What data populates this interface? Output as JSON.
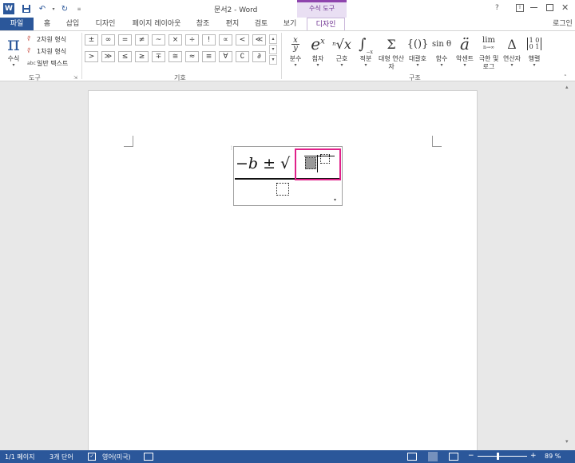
{
  "window": {
    "title": "문서2 - Word",
    "contextual_group": "수식 도구",
    "help": "?",
    "signin": "로그인"
  },
  "tabs": [
    {
      "label": "파일"
    },
    {
      "label": "홈"
    },
    {
      "label": "삽입"
    },
    {
      "label": "디자인"
    },
    {
      "label": "페이지 레이아웃"
    },
    {
      "label": "참조"
    },
    {
      "label": "편지"
    },
    {
      "label": "검토"
    },
    {
      "label": "보기"
    },
    {
      "label": "디자인"
    }
  ],
  "tools_group": {
    "equation_label": "수식",
    "professional": "2차원 형식",
    "linear": "1차원 형식",
    "normal_text": "일반 텍스트",
    "group_label": "도구"
  },
  "symbols": {
    "row1": [
      "±",
      "∞",
      "=",
      "≠",
      "~",
      "×",
      "÷",
      "!",
      "∝",
      "<",
      "≪"
    ],
    "row2": [
      ">",
      "≫",
      "≤",
      "≥",
      "∓",
      "≅",
      "≈",
      "≡",
      "∀",
      "∁",
      "∂"
    ],
    "group_label": "기호"
  },
  "structures": {
    "items": [
      {
        "icon": "x/y",
        "label": "분수"
      },
      {
        "icon": "eˣ",
        "label": "첨자"
      },
      {
        "icon": "ⁿ√x",
        "label": "근호"
      },
      {
        "icon": "∫",
        "label": "적분"
      },
      {
        "icon": "Σ",
        "label": "대형 연산자"
      },
      {
        "icon": "{()}",
        "label": "대괄호"
      },
      {
        "icon": "sinθ",
        "label": "함수"
      },
      {
        "icon": "ä",
        "label": "악센트"
      },
      {
        "icon": "lim",
        "label": "극한 및 로그"
      },
      {
        "icon": "Δ",
        "label": "연산자"
      },
      {
        "icon": "[10;01]",
        "label": "행렬"
      }
    ],
    "group_label": "구조"
  },
  "equation": {
    "numerator_text": "−b ± √"
  },
  "status": {
    "page": "1/1 페이지",
    "words": "3개 단어",
    "language": "영어(미국)",
    "zoom": "89 %"
  }
}
